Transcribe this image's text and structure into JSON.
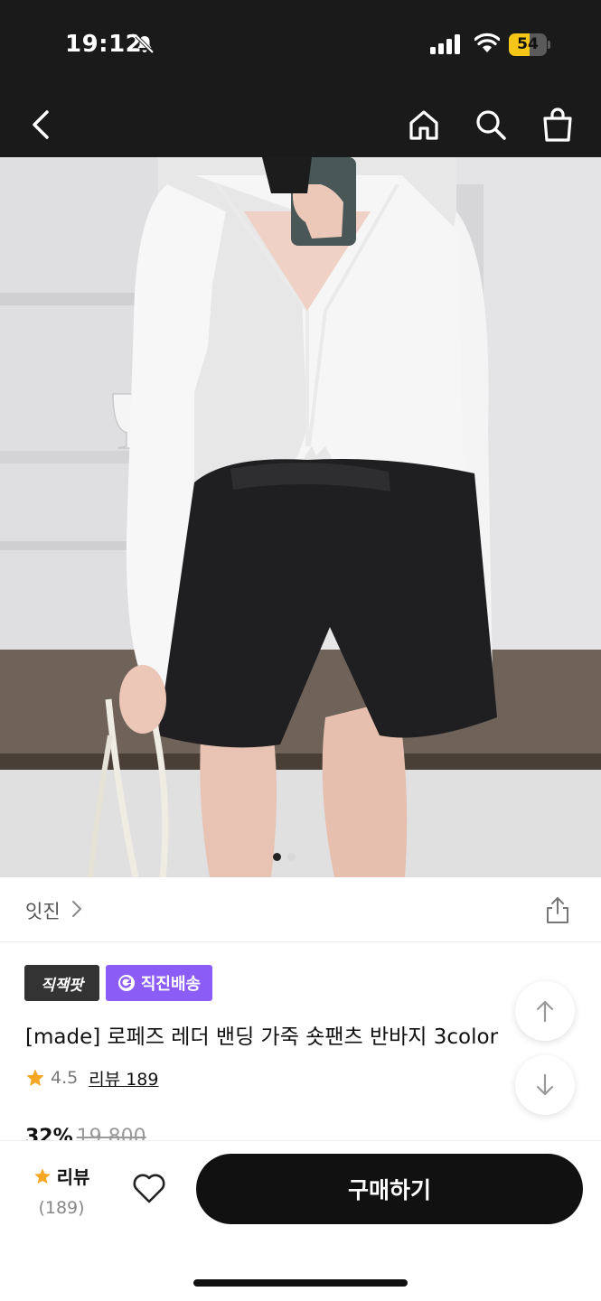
{
  "status_bar": {
    "time": "19:12",
    "battery": "54",
    "battery_level": 0.54
  },
  "colors": {
    "accent_purple": "#8b5cf6",
    "battery_yellow": "#f5c518",
    "star": "#f5a623",
    "dark": "#1a1a1a"
  },
  "nav": {
    "icons": [
      "back-arrow-icon",
      "home-icon",
      "search-icon",
      "shopping-bag-icon"
    ]
  },
  "carousel": {
    "total": 2,
    "current": 1
  },
  "shop": {
    "name": "잇진"
  },
  "badges": {
    "first": "직잭팟",
    "second": "직진배송"
  },
  "product": {
    "title": "[made] 로페즈 레더 밴딩 가죽 숏팬츠 반바지 3color",
    "rating": "4.5",
    "review_link": "리뷰 189",
    "price_peek": "32%",
    "price_peek_old": "19,800"
  },
  "bottom": {
    "review_label": "리뷰",
    "review_count": "(189)",
    "buy_label": "구매하기"
  }
}
